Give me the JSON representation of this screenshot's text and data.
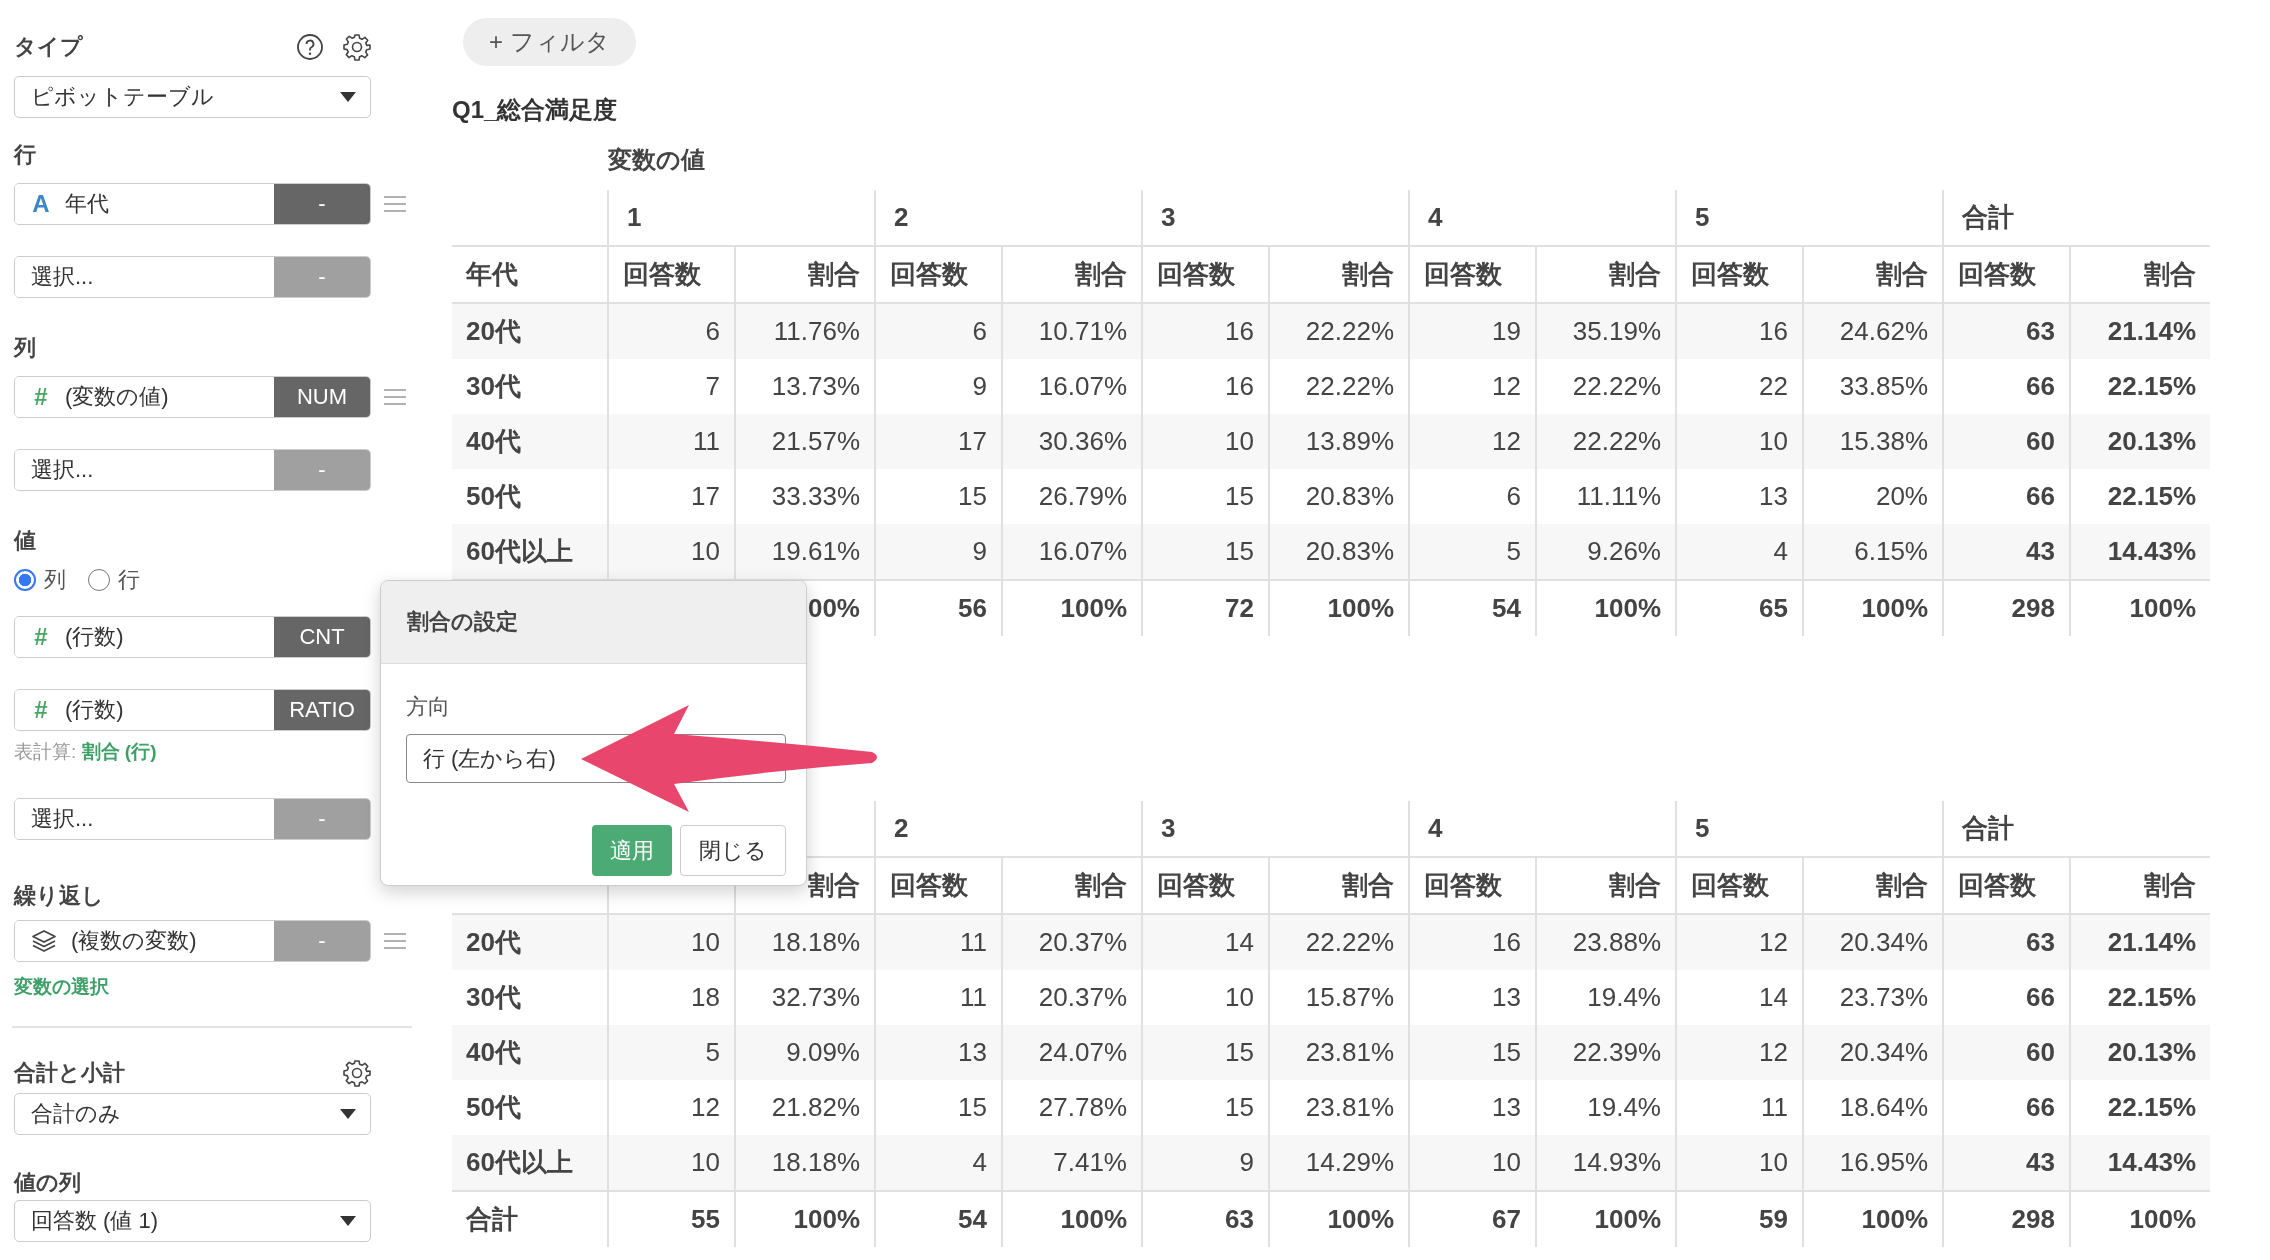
{
  "sidebar": {
    "type": {
      "label": "タイプ",
      "value": "ピボットテーブル"
    },
    "row": {
      "label": "行",
      "slots": [
        {
          "kind": "string",
          "glyph": "A",
          "name": "年代",
          "badge": "-",
          "badge_on": true,
          "draggable": true
        },
        {
          "kind": "empty",
          "name": "選択...",
          "badge": "-",
          "badge_on": false,
          "draggable": false
        }
      ]
    },
    "column": {
      "label": "列",
      "slots": [
        {
          "kind": "number",
          "glyph": "#",
          "name": "(変数の値)",
          "badge": "NUM",
          "badge_on": true,
          "draggable": true
        },
        {
          "kind": "empty",
          "name": "選択...",
          "badge": "-",
          "badge_on": false,
          "draggable": false
        }
      ]
    },
    "value": {
      "label": "値",
      "orientation": [
        {
          "label": "列",
          "selected": true
        },
        {
          "label": "行",
          "selected": false
        }
      ],
      "slots": [
        {
          "kind": "number",
          "glyph": "#",
          "name": "(行数)",
          "badge": "CNT",
          "badge_on": true,
          "draggable": false
        },
        {
          "kind": "number",
          "glyph": "#",
          "name": "(行数)",
          "badge": "RATIO",
          "badge_on": true,
          "draggable": false,
          "note": {
            "prefix": "表計算:",
            "link": "割合 (行)"
          }
        },
        {
          "kind": "empty",
          "name": "選択...",
          "badge": "-",
          "badge_on": false,
          "draggable": false
        }
      ]
    },
    "repeat": {
      "label": "繰り返し",
      "slots": [
        {
          "kind": "multi",
          "name": "(複数の変数)",
          "badge": "-",
          "badge_on": false,
          "draggable": true
        }
      ],
      "link": "変数の選択"
    },
    "totals": {
      "label": "合計と小計",
      "value": "合計のみ"
    },
    "value_column": {
      "label": "値の列",
      "value": "回答数 (値 1)"
    }
  },
  "filter_button": "+ フィルタ",
  "tables": [
    {
      "title": "Q1_総合満足度",
      "caption": "変数の値",
      "row_header": "年代",
      "groups": [
        {
          "label": "1",
          "emphasis": false,
          "count_header": "回答数",
          "ratio_header": "割合"
        },
        {
          "label": "2",
          "emphasis": false,
          "count_header": "回答数",
          "ratio_header": "割合"
        },
        {
          "label": "3",
          "emphasis": false,
          "count_header": "回答数",
          "ratio_header": "割合"
        },
        {
          "label": "4",
          "emphasis": false,
          "count_header": "回答数",
          "ratio_header": "割合"
        },
        {
          "label": "5",
          "emphasis": false,
          "count_header": "回答数",
          "ratio_header": "割合"
        },
        {
          "label": "合計",
          "emphasis": true,
          "count_header": "回答数",
          "ratio_header": "割合"
        }
      ],
      "rows": [
        {
          "label": "20代",
          "cells": [
            "6",
            "11.76%",
            "6",
            "10.71%",
            "16",
            "22.22%",
            "19",
            "35.19%",
            "16",
            "24.62%",
            "63",
            "21.14%"
          ]
        },
        {
          "label": "30代",
          "cells": [
            "7",
            "13.73%",
            "9",
            "16.07%",
            "16",
            "22.22%",
            "12",
            "22.22%",
            "22",
            "33.85%",
            "66",
            "22.15%"
          ]
        },
        {
          "label": "40代",
          "cells": [
            "11",
            "21.57%",
            "17",
            "30.36%",
            "10",
            "13.89%",
            "12",
            "22.22%",
            "10",
            "15.38%",
            "60",
            "20.13%"
          ]
        },
        {
          "label": "50代",
          "cells": [
            "17",
            "33.33%",
            "15",
            "26.79%",
            "15",
            "20.83%",
            "6",
            "11.11%",
            "13",
            "20%",
            "66",
            "22.15%"
          ]
        },
        {
          "label": "60代以上",
          "cells": [
            "10",
            "19.61%",
            "9",
            "16.07%",
            "15",
            "20.83%",
            "5",
            "9.26%",
            "4",
            "6.15%",
            "43",
            "14.43%"
          ]
        }
      ],
      "total": {
        "cells": [
          {},
          {
            "text": "00%"
          },
          {
            "text": "56"
          },
          {
            "text": "100%"
          },
          {
            "text": "72"
          },
          {
            "text": "100%"
          },
          {
            "text": "54"
          },
          {
            "text": "100%"
          },
          {
            "text": "65"
          },
          {
            "text": "100%"
          },
          {
            "text": "298"
          },
          {
            "text": "100%"
          }
        ]
      }
    },
    {
      "groups": [
        {
          "emphasis": false,
          "ratio_header": "割合"
        },
        {
          "label": "2",
          "emphasis": false,
          "count_header": "回答数",
          "ratio_header": "割合"
        },
        {
          "label": "3",
          "emphasis": false,
          "count_header": "回答数",
          "ratio_header": "割合"
        },
        {
          "label": "4",
          "emphasis": false,
          "count_header": "回答数",
          "ratio_header": "割合"
        },
        {
          "label": "5",
          "emphasis": false,
          "count_header": "回答数",
          "ratio_header": "割合"
        },
        {
          "label": "合計",
          "emphasis": true,
          "count_header": "回答数",
          "ratio_header": "割合"
        }
      ],
      "rows": [
        {
          "label": "20代",
          "cells": [
            "10",
            "18.18%",
            "11",
            "20.37%",
            "14",
            "22.22%",
            "16",
            "23.88%",
            "12",
            "20.34%",
            "63",
            "21.14%"
          ]
        },
        {
          "label": "30代",
          "cells": [
            "18",
            "32.73%",
            "11",
            "20.37%",
            "10",
            "15.87%",
            "13",
            "19.4%",
            "14",
            "23.73%",
            "66",
            "22.15%"
          ]
        },
        {
          "label": "40代",
          "cells": [
            "5",
            "9.09%",
            "13",
            "24.07%",
            "15",
            "23.81%",
            "15",
            "22.39%",
            "12",
            "20.34%",
            "60",
            "20.13%"
          ]
        },
        {
          "label": "50代",
          "cells": [
            "12",
            "21.82%",
            "15",
            "27.78%",
            "15",
            "23.81%",
            "13",
            "19.4%",
            "11",
            "18.64%",
            "66",
            "22.15%"
          ]
        },
        {
          "label": "60代以上",
          "cells": [
            "10",
            "18.18%",
            "4",
            "7.41%",
            "9",
            "14.29%",
            "10",
            "14.93%",
            "10",
            "16.95%",
            "43",
            "14.43%"
          ]
        }
      ],
      "total": {
        "label": "合計",
        "cells": [
          {
            "text": "55"
          },
          {
            "text": "100%"
          },
          {
            "text": "54"
          },
          {
            "text": "100%"
          },
          {
            "text": "63"
          },
          {
            "text": "100%"
          },
          {
            "text": "67"
          },
          {
            "text": "100%"
          },
          {
            "text": "59"
          },
          {
            "text": "100%"
          },
          {
            "text": "298"
          },
          {
            "text": "100%"
          }
        ]
      }
    }
  ],
  "popup": {
    "title": "割合の設定",
    "field_label": "方向",
    "value": "行 (左から右)",
    "buttons": [
      {
        "label": "適用",
        "kind": "primary"
      },
      {
        "label": "閉じる",
        "kind": "default"
      }
    ]
  }
}
